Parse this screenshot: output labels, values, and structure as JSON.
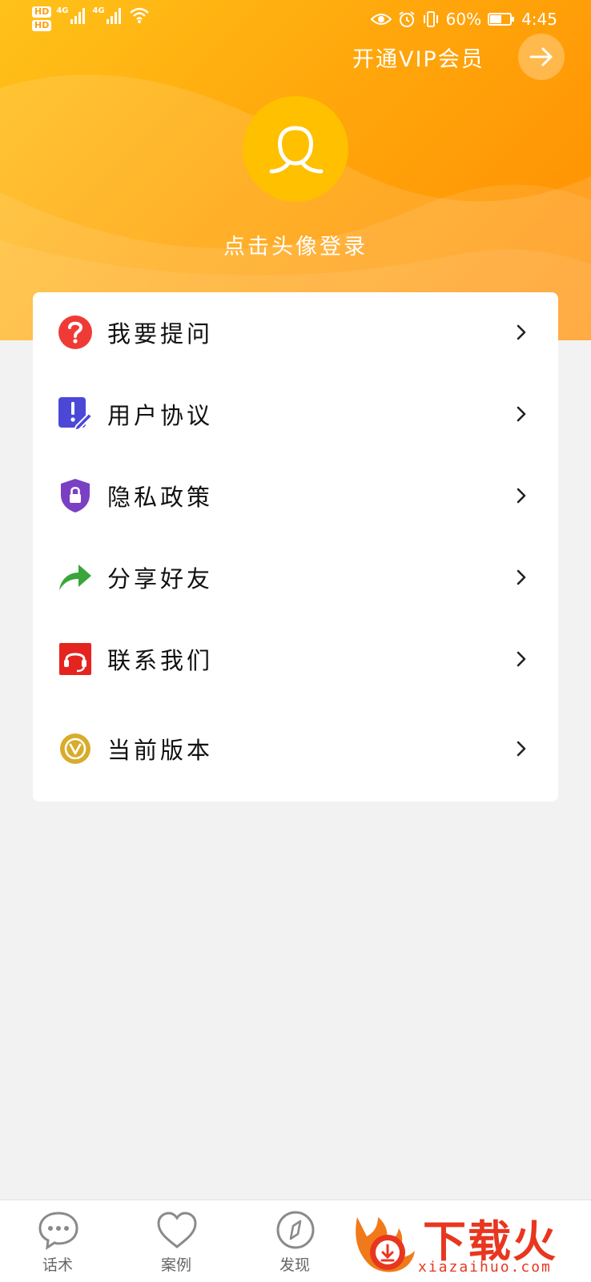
{
  "status_bar": {
    "hd1": "HD",
    "hd2": "HD",
    "net1": "4G",
    "net2": "4G",
    "battery_text": "60%",
    "battery_level": 0.6,
    "time": "4:45"
  },
  "header": {
    "vip_label": "开通VIP会员",
    "login_prompt": "点击头像登录",
    "colors": {
      "gradient_start": "#ffc21a",
      "gradient_end": "#ff8d00",
      "avatar_bg": "#ffc000"
    }
  },
  "menu": {
    "items": [
      {
        "label": "我要提问",
        "icon": "question-icon",
        "color": "#ef3b36"
      },
      {
        "label": "用户协议",
        "icon": "agreement-icon",
        "color": "#4b48d8"
      },
      {
        "label": "隐私政策",
        "icon": "privacy-shield-icon",
        "color": "#7b3fc4"
      },
      {
        "label": "分享好友",
        "icon": "share-arrow-icon",
        "color": "#3aa53a"
      },
      {
        "label": "联系我们",
        "icon": "headset-icon",
        "color": "#e52420"
      },
      {
        "label": "当前版本",
        "icon": "version-icon",
        "color": "#d8ac2a"
      }
    ]
  },
  "tabbar": {
    "tabs": [
      {
        "label": "话术",
        "icon": "chat-bubble-icon"
      },
      {
        "label": "案例",
        "icon": "heart-icon"
      },
      {
        "label": "发现",
        "icon": "compass-icon"
      }
    ]
  },
  "watermark": {
    "title": "下载火",
    "site": "xiazaihuo.com",
    "color": "#e8361f"
  }
}
